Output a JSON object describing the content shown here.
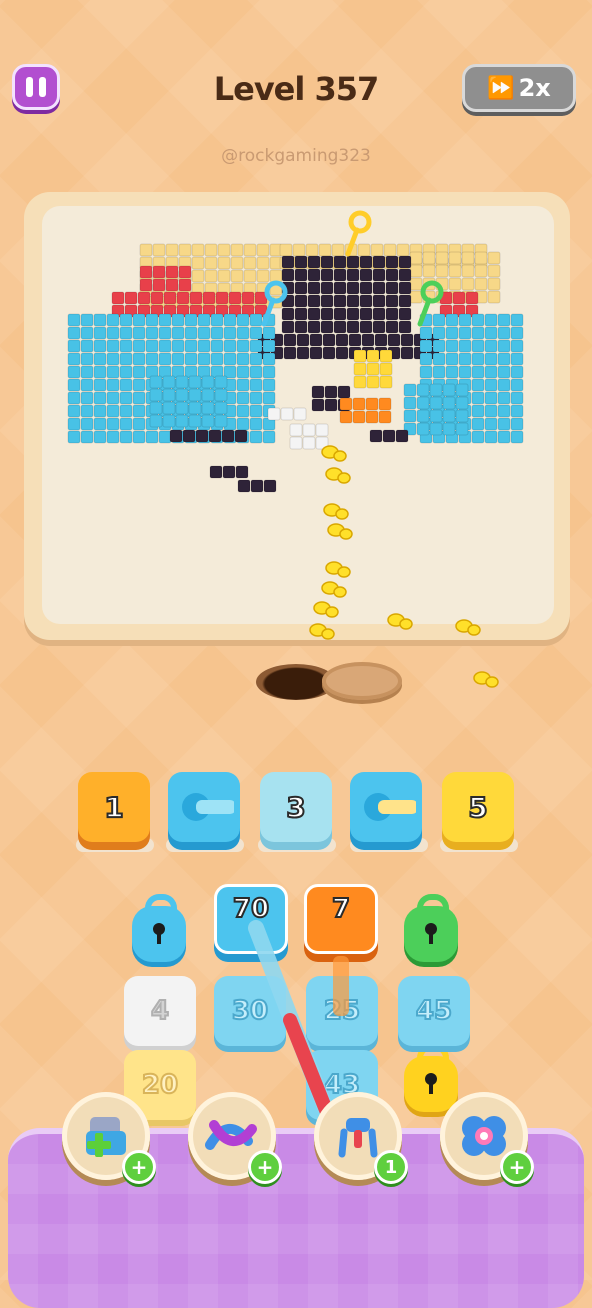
{
  "header": {
    "pause_icon": "pause-icon",
    "level_title": "Level 357",
    "speed_label": "2x",
    "speed_icon": "fast-forward-icon"
  },
  "watermark": "@rockgaming323",
  "colors": {
    "background": "#f6c48e",
    "board_frame": "#f6dfb8",
    "dock": "#c98ae6",
    "tile_blue": "#4cc4ee",
    "tile_orange": "#ffb02a",
    "tile_yellow": "#ffd93a",
    "pixel_navy": "#2e2338",
    "pixel_sky": "#48c2e6",
    "pixel_cream": "#f7d888",
    "pixel_red": "#e8404a"
  },
  "queue_tiles": [
    {
      "label": "1",
      "color": "orange"
    },
    {
      "label": "",
      "color": "blue",
      "icon": "pipe-connector-icon"
    },
    {
      "label": "3",
      "color": "light-blue"
    },
    {
      "label": "",
      "color": "blue",
      "icon": "pipe-connector-icon"
    },
    {
      "label": "5",
      "color": "yellow"
    }
  ],
  "active_tiles": [
    {
      "label": "70",
      "color": "blue"
    },
    {
      "label": "7",
      "color": "orange"
    }
  ],
  "locked_tiles": [
    {
      "color": "blue",
      "icon": "padlock-icon"
    },
    {
      "color": "green",
      "icon": "padlock-icon"
    },
    {
      "color": "yellow",
      "icon": "padlock-icon"
    }
  ],
  "grid_tiles": [
    {
      "label": "4"
    },
    {
      "label": "30"
    },
    {
      "label": "25"
    },
    {
      "label": "45"
    },
    {
      "label": "20"
    },
    {
      "label": "43"
    }
  ],
  "boosters": [
    {
      "name": "add-slot-booster",
      "icon": "box-plus-icon",
      "badge": "+"
    },
    {
      "name": "shuffle-booster",
      "icon": "shuffle-arrows-icon",
      "badge": "+"
    },
    {
      "name": "magnet-booster",
      "icon": "claw-icon",
      "badge": "1"
    },
    {
      "name": "freeze-booster",
      "icon": "flower-icon",
      "badge": "+"
    }
  ]
}
